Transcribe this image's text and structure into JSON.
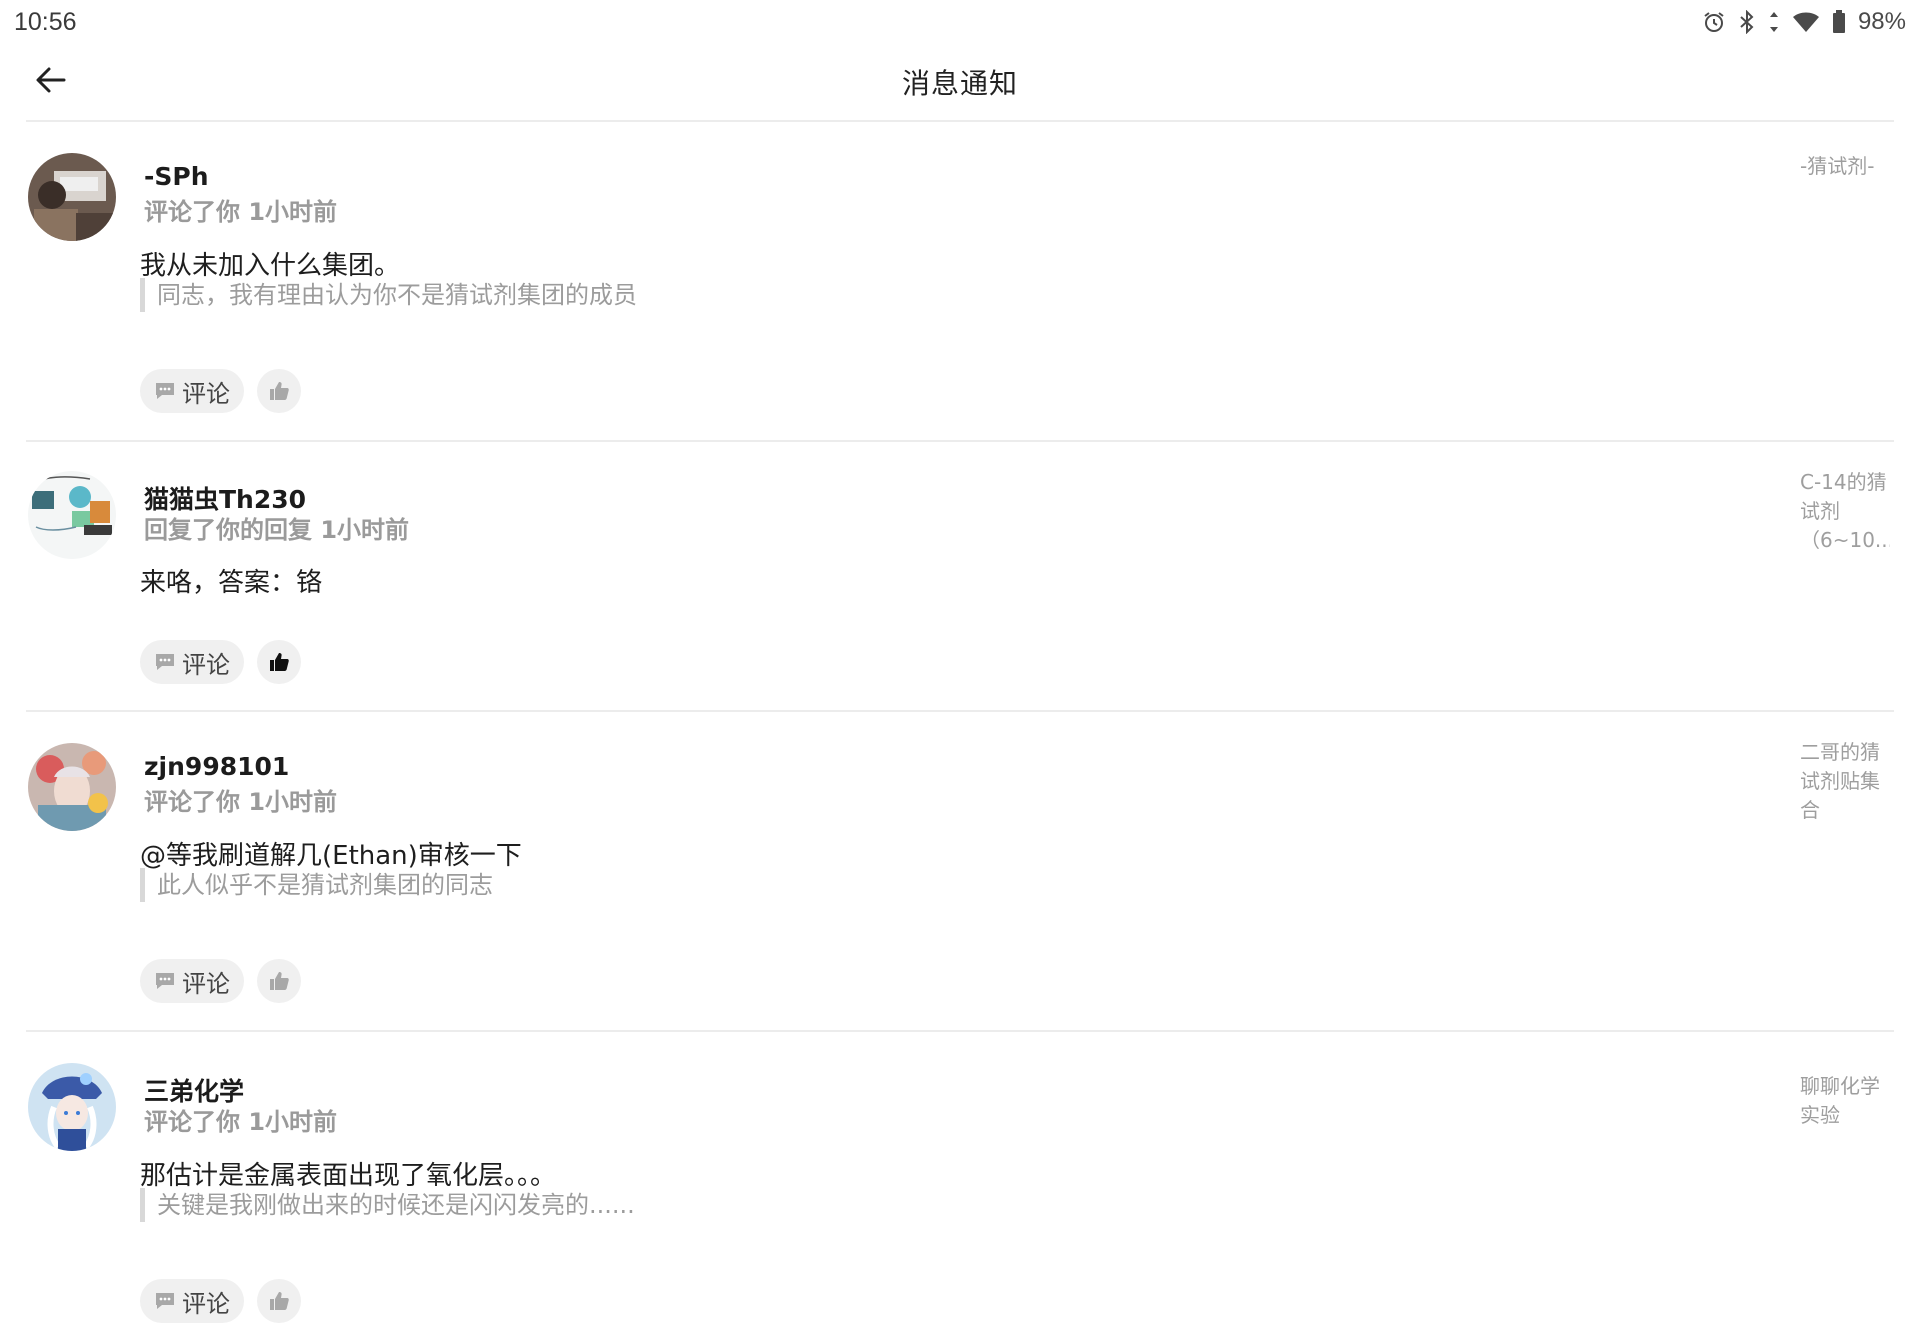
{
  "status": {
    "time": "10:56",
    "battery": "98%"
  },
  "header": {
    "title": "消息通知"
  },
  "notifications": [
    {
      "username": "-SPh",
      "action": "评论了你 1小时前",
      "content": "我从未加入什么集团。",
      "quote": "同志，我有理由认为你不是猜试剂集团的成员",
      "comment_label": "评论",
      "liked": false,
      "topic": [
        "-猜试剂-"
      ]
    },
    {
      "username": "猫猫虫Th230",
      "action": "回复了你的回复 1小时前",
      "content": "来咯，答案：铬",
      "quote": "",
      "comment_label": "评论",
      "liked": true,
      "topic": [
        "C-14的猜",
        "试剂",
        "（6~10..."
      ]
    },
    {
      "username": "zjn998101",
      "action": "评论了你 1小时前",
      "content": "@等我刷道解几(Ethan)审核一下",
      "quote": "此人似乎不是猜试剂集团的同志",
      "comment_label": "评论",
      "liked": false,
      "topic": [
        "二哥的猜",
        "试剂贴集",
        "合"
      ]
    },
    {
      "username": "三弟化学",
      "action": "评论了你 1小时前",
      "content": "那估计是金属表面出现了氧化层。。。",
      "quote": "关键是我刚做出来的时候还是闪闪发亮的......",
      "comment_label": "评论",
      "liked": false,
      "topic": [
        "聊聊化学",
        "实验"
      ]
    }
  ],
  "colors": {
    "liked_icon": "#111111",
    "unliked_icon": "#a8a8a8",
    "comment_icon": "#a8a8a8"
  }
}
